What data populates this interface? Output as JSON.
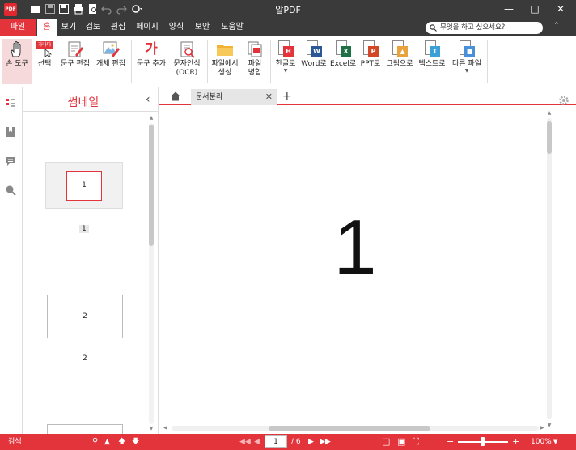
{
  "window": {
    "app_icon_text": "PDF",
    "title": "알PDF"
  },
  "menu": {
    "file": "파일",
    "tabs": [
      "홈",
      "보기",
      "검토",
      "편집",
      "페이지",
      "양식",
      "보안",
      "도움말"
    ],
    "active_tab": "홈",
    "search_placeholder": "무엇을 하고 싶으세요?"
  },
  "ribbon": {
    "hand_tool": "손 도구",
    "select": "선택",
    "edit_text": "문구 편집",
    "edit_object": "개체 편집",
    "add_text": "문구 추가",
    "ocr_line1": "문자인식",
    "ocr_line2": "(OCR)",
    "create_from_file_line1": "파일에서",
    "create_from_file_line2": "생성",
    "merge_line1": "파일",
    "merge_line2": "병합",
    "to_hangul": "한글로",
    "to_word": "Word로",
    "to_excel": "Excel로",
    "to_ppt": "PPT로",
    "to_image": "그림으로",
    "to_text": "텍스트로",
    "to_other": "다른 파일",
    "select_icon_text": "가나다",
    "add_text_icon_text": "가",
    "badge_colors": {
      "hangul": "#e3343c",
      "word": "#2b5797",
      "excel": "#1e7145",
      "ppt": "#d24726",
      "image": "#e8a33c",
      "text": "#3aa0d8",
      "other": "#4a90d9"
    }
  },
  "thumbnails": {
    "title": "썸네일",
    "pages": [
      {
        "label": "1",
        "page_text": "1"
      },
      {
        "label": "2",
        "page_text": "2"
      }
    ]
  },
  "document": {
    "tab_name": "문서분리",
    "page_content": "1"
  },
  "status": {
    "search_label": "검색",
    "current_page": "1",
    "total_pages": "/ 6",
    "zoom": "100%"
  },
  "colors": {
    "accent": "#e3343c",
    "titlebar": "#3a3a3a"
  }
}
